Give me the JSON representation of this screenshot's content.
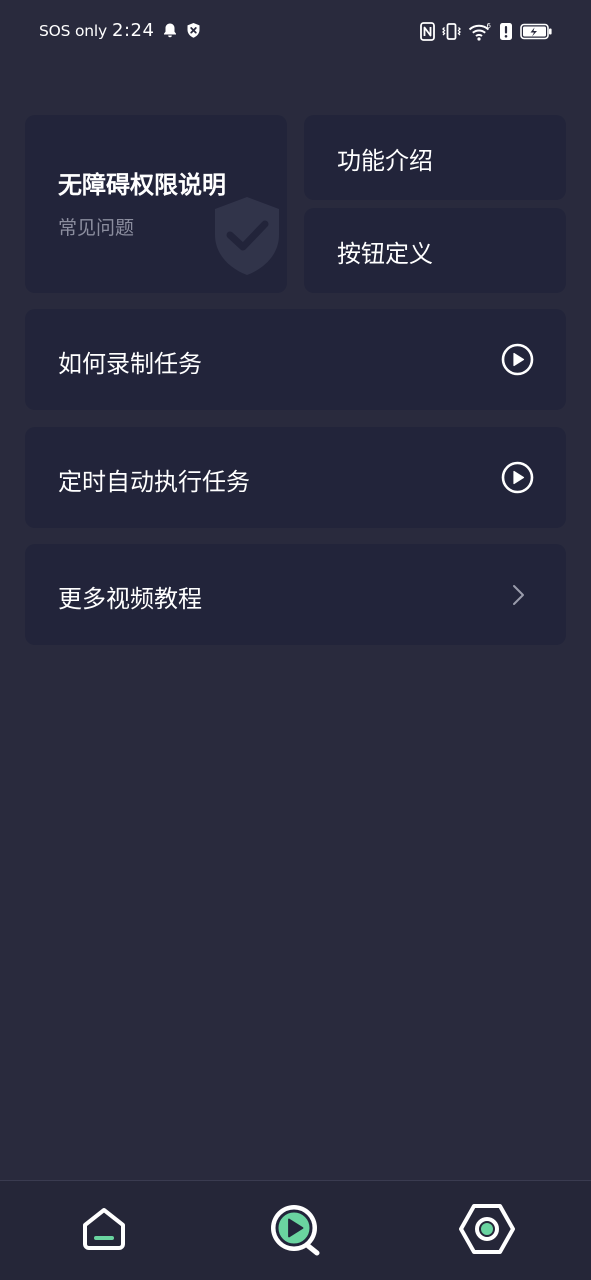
{
  "status_bar": {
    "carrier": "SOS only",
    "time": "2:24",
    "icons": [
      "bell-icon",
      "shield-x-icon",
      "nfc-icon",
      "vibrate-icon",
      "wifi-6-icon",
      "alert-icon",
      "battery-icon"
    ]
  },
  "cards": {
    "permission": {
      "title": "无障碍权限说明",
      "subtitle": "常见问题",
      "icon": "shield-check-icon"
    },
    "features_label": "功能介绍",
    "buttons_label": "按钮定义",
    "record_task_label": "如何录制任务",
    "scheduled_task_label": "定时自动执行任务",
    "more_videos_label": "更多视频教程"
  },
  "bottom_nav": {
    "items": [
      "home-icon",
      "tutorial-play-icon",
      "settings-hex-icon"
    ],
    "active_index": 1
  },
  "colors": {
    "background": "#292a3d",
    "card": "#22243a",
    "accent": "#6ad4a0",
    "muted_text": "#8b8d9e"
  }
}
